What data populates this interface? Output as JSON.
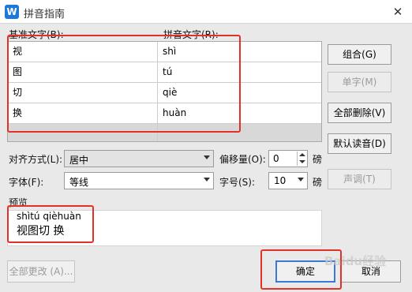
{
  "window": {
    "title": "拼音指南",
    "app_icon_letter": "W",
    "close_glyph": "✕"
  },
  "labels": {
    "base_text": "基准文字(B):",
    "pinyin_text": "拼音文字(R):"
  },
  "grid": {
    "rows": [
      {
        "base": "视",
        "pinyin": "shì"
      },
      {
        "base": "图",
        "pinyin": "tú"
      },
      {
        "base": "切",
        "pinyin": "qiè"
      },
      {
        "base": "换",
        "pinyin": "huàn"
      },
      {
        "base": "",
        "pinyin": ""
      }
    ]
  },
  "side_buttons": {
    "combine": "组合(G)",
    "single": "单字(M)",
    "delete_all": "全部删除(V)",
    "default_reading": "默认读音(D)",
    "tone": "声调(T)"
  },
  "options": {
    "align_label": "对齐方式(L):",
    "align_value": "居中",
    "offset_label": "偏移量(O):",
    "offset_value": "0",
    "offset_unit": "磅",
    "font_label": "字体(F):",
    "font_value": "等线",
    "size_label": "字号(S):",
    "size_value": "10",
    "size_unit": "磅"
  },
  "preview": {
    "label": "预览",
    "pinyin_line": "shìtú qièhuàn",
    "chars_line": "视图切 换"
  },
  "bottom": {
    "apply_all": "全部更改 (A)...",
    "ok": "确定",
    "cancel": "取消"
  },
  "watermark": "Baidu经验",
  "colors": {
    "highlight": "#e0322b",
    "app_icon": "#1e78d7",
    "focus": "#3a7ad6"
  }
}
